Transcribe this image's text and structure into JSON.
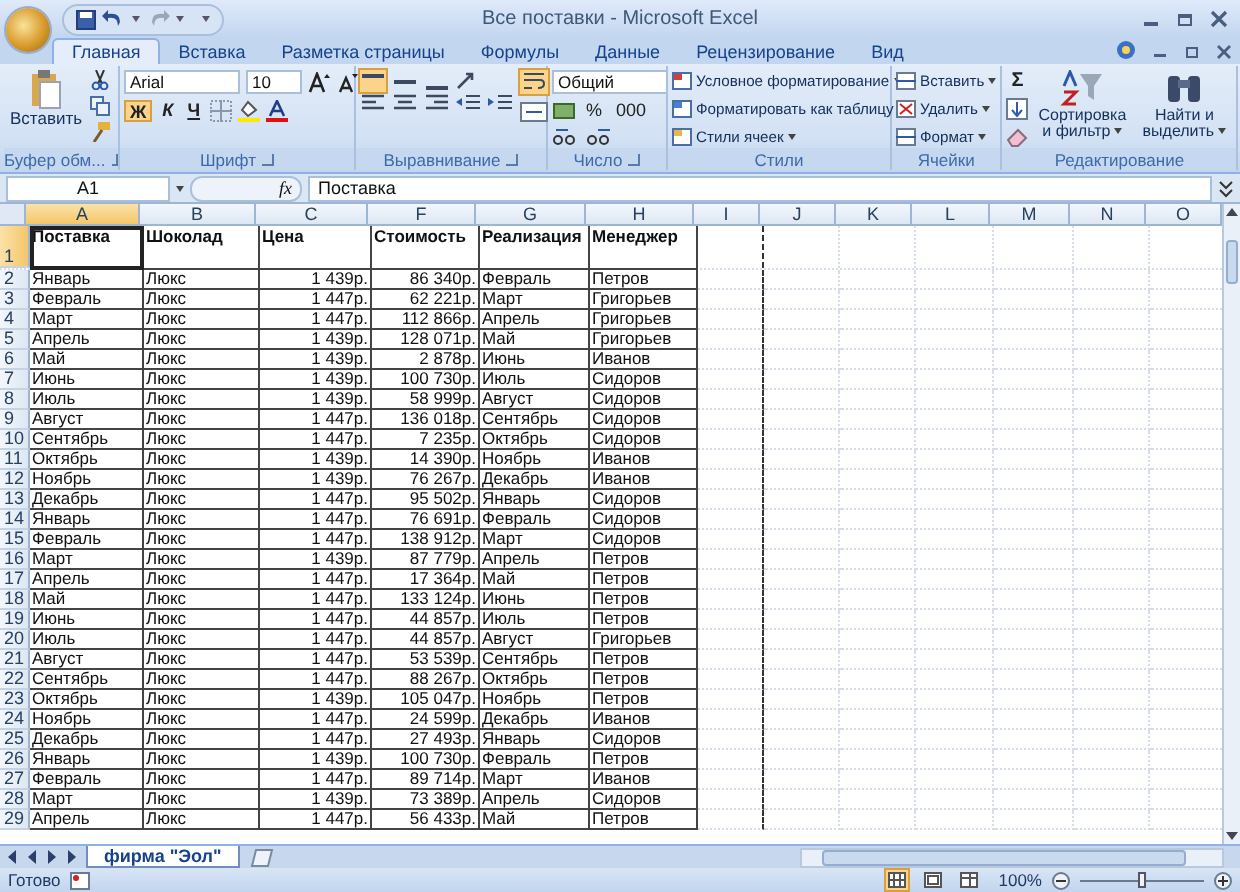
{
  "window": {
    "title": "Все поставки - Microsoft Excel"
  },
  "tabs": [
    {
      "label": "Главная",
      "selected": true
    },
    {
      "label": "Вставка",
      "selected": false
    },
    {
      "label": "Разметка страницы",
      "selected": false
    },
    {
      "label": "Формулы",
      "selected": false
    },
    {
      "label": "Данные",
      "selected": false
    },
    {
      "label": "Рецензирование",
      "selected": false
    },
    {
      "label": "Вид",
      "selected": false
    }
  ],
  "clipboard": {
    "paste": "Вставить",
    "label": "Буфер обм..."
  },
  "font": {
    "name": "Arial",
    "size": "10",
    "bold": "Ж",
    "italic": "К",
    "underline": "Ч",
    "label": "Шрифт"
  },
  "alignment": {
    "label": "Выравнивание"
  },
  "number": {
    "format": "Общий",
    "percent": "%",
    "thousands": "000",
    "label": "Число"
  },
  "styles": {
    "items": [
      "Условное форматирование",
      "Форматировать как таблицу",
      "Стили ячеек"
    ],
    "label": "Стили"
  },
  "cells": {
    "items": [
      "Вставить",
      "Удалить",
      "Формат"
    ],
    "label": "Ячейки"
  },
  "editing": {
    "sum": "Σ",
    "sort": "Сортировка и фильтр",
    "find": "Найти и выделить",
    "label": "Редактирование"
  },
  "formula_bar": {
    "cell": "A1",
    "function_label": "fx",
    "value": "Поставка"
  },
  "sheet": {
    "columns": [
      {
        "label": "A",
        "kind": "text",
        "selected": true
      },
      {
        "label": "B",
        "kind": "text",
        "selected": false
      },
      {
        "label": "C",
        "kind": "number",
        "selected": false
      },
      {
        "label": "F",
        "kind": "number",
        "selected": false
      },
      {
        "label": "G",
        "kind": "text",
        "selected": false
      },
      {
        "label": "H",
        "kind": "text",
        "selected": false
      },
      {
        "label": "I",
        "kind": "text",
        "selected": false
      },
      {
        "label": "J",
        "kind": "text",
        "selected": false
      },
      {
        "label": "K",
        "kind": "text",
        "selected": false
      },
      {
        "label": "L",
        "kind": "text",
        "selected": false
      },
      {
        "label": "M",
        "kind": "text",
        "selected": false
      },
      {
        "label": "N",
        "kind": "text",
        "selected": false
      },
      {
        "label": "O",
        "kind": "text",
        "selected": false
      }
    ],
    "rows": [
      {
        "number": "1",
        "kind": "header",
        "selected": true,
        "cells": [
          "Поставка",
          "Шоколад",
          "Цена",
          "Стоимость",
          "Реализация",
          "Менеджер"
        ]
      },
      {
        "number": "2",
        "kind": "data",
        "selected": false,
        "cells": [
          "Январь",
          "Люкс",
          "1 439р.",
          "86 340р.",
          "Февраль",
          "Петров"
        ]
      },
      {
        "number": "3",
        "kind": "data",
        "selected": false,
        "cells": [
          "Февраль",
          "Люкс",
          "1 447р.",
          "62 221р.",
          "Март",
          "Григорьев"
        ]
      },
      {
        "number": "4",
        "kind": "data",
        "selected": false,
        "cells": [
          "Март",
          "Люкс",
          "1 447р.",
          "112 866р.",
          "Апрель",
          "Григорьев"
        ]
      },
      {
        "number": "5",
        "kind": "data",
        "selected": false,
        "cells": [
          "Апрель",
          "Люкс",
          "1 439р.",
          "128 071р.",
          "Май",
          "Григорьев"
        ]
      },
      {
        "number": "6",
        "kind": "data",
        "selected": false,
        "cells": [
          "Май",
          "Люкс",
          "1 439р.",
          "2 878р.",
          "Июнь",
          "Иванов"
        ]
      },
      {
        "number": "7",
        "kind": "data",
        "selected": false,
        "cells": [
          "Июнь",
          "Люкс",
          "1 439р.",
          "100 730р.",
          "Июль",
          "Сидоров"
        ]
      },
      {
        "number": "8",
        "kind": "data",
        "selected": false,
        "cells": [
          "Июль",
          "Люкс",
          "1 439р.",
          "58 999р.",
          "Август",
          "Сидоров"
        ]
      },
      {
        "number": "9",
        "kind": "data",
        "selected": false,
        "cells": [
          "Август",
          "Люкс",
          "1 447р.",
          "136 018р.",
          "Сентябрь",
          "Сидоров"
        ]
      },
      {
        "number": "10",
        "kind": "data",
        "selected": false,
        "cells": [
          "Сентябрь",
          "Люкс",
          "1 447р.",
          "7 235р.",
          "Октябрь",
          "Сидоров"
        ]
      },
      {
        "number": "11",
        "kind": "data",
        "selected": false,
        "cells": [
          "Октябрь",
          "Люкс",
          "1 439р.",
          "14 390р.",
          "Ноябрь",
          "Иванов"
        ]
      },
      {
        "number": "12",
        "kind": "data",
        "selected": false,
        "cells": [
          "Ноябрь",
          "Люкс",
          "1 439р.",
          "76 267р.",
          "Декабрь",
          "Иванов"
        ]
      },
      {
        "number": "13",
        "kind": "data",
        "selected": false,
        "cells": [
          "Декабрь",
          "Люкс",
          "1 447р.",
          "95 502р.",
          "Январь",
          "Сидоров"
        ]
      },
      {
        "number": "14",
        "kind": "data",
        "selected": false,
        "cells": [
          "Январь",
          "Люкс",
          "1 447р.",
          "76 691р.",
          "Февраль",
          "Сидоров"
        ]
      },
      {
        "number": "15",
        "kind": "data",
        "selected": false,
        "cells": [
          "Февраль",
          "Люкс",
          "1 447р.",
          "138 912р.",
          "Март",
          "Сидоров"
        ]
      },
      {
        "number": "16",
        "kind": "data",
        "selected": false,
        "cells": [
          "Март",
          "Люкс",
          "1 439р.",
          "87 779р.",
          "Апрель",
          "Петров"
        ]
      },
      {
        "number": "17",
        "kind": "data",
        "selected": false,
        "cells": [
          "Апрель",
          "Люкс",
          "1 447р.",
          "17 364р.",
          "Май",
          "Петров"
        ]
      },
      {
        "number": "18",
        "kind": "data",
        "selected": false,
        "cells": [
          "Май",
          "Люкс",
          "1 447р.",
          "133 124р.",
          "Июнь",
          "Петров"
        ]
      },
      {
        "number": "19",
        "kind": "data",
        "selected": false,
        "cells": [
          "Июнь",
          "Люкс",
          "1 447р.",
          "44 857р.",
          "Июль",
          "Петров"
        ]
      },
      {
        "number": "20",
        "kind": "data",
        "selected": false,
        "cells": [
          "Июль",
          "Люкс",
          "1 447р.",
          "44 857р.",
          "Август",
          "Григорьев"
        ]
      },
      {
        "number": "21",
        "kind": "data",
        "selected": false,
        "cells": [
          "Август",
          "Люкс",
          "1 447р.",
          "53 539р.",
          "Сентябрь",
          "Петров"
        ]
      },
      {
        "number": "22",
        "kind": "data",
        "selected": false,
        "cells": [
          "Сентябрь",
          "Люкс",
          "1 447р.",
          "88 267р.",
          "Октябрь",
          "Петров"
        ]
      },
      {
        "number": "23",
        "kind": "data",
        "selected": false,
        "cells": [
          "Октябрь",
          "Люкс",
          "1 439р.",
          "105 047р.",
          "Ноябрь",
          "Петров"
        ]
      },
      {
        "number": "24",
        "kind": "data",
        "selected": false,
        "cells": [
          "Ноябрь",
          "Люкс",
          "1 447р.",
          "24 599р.",
          "Декабрь",
          "Иванов"
        ]
      },
      {
        "number": "25",
        "kind": "data",
        "selected": false,
        "cells": [
          "Декабрь",
          "Люкс",
          "1 447р.",
          "27 493р.",
          "Январь",
          "Сидоров"
        ]
      },
      {
        "number": "26",
        "kind": "data",
        "selected": false,
        "cells": [
          "Январь",
          "Люкс",
          "1 439р.",
          "100 730р.",
          "Февраль",
          "Петров"
        ]
      },
      {
        "number": "27",
        "kind": "data",
        "selected": false,
        "cells": [
          "Февраль",
          "Люкс",
          "1 447р.",
          "89 714р.",
          "Март",
          "Иванов"
        ]
      },
      {
        "number": "28",
        "kind": "data",
        "selected": false,
        "cells": [
          "Март",
          "Люкс",
          "1 439р.",
          "73 389р.",
          "Апрель",
          "Сидоров"
        ]
      },
      {
        "number": "29",
        "kind": "data",
        "selected": false,
        "cells": [
          "Апрель",
          "Люкс",
          "1 447р.",
          "56 433р.",
          "Май",
          "Петров"
        ]
      }
    ]
  },
  "sheet_tabs": [
    {
      "label": "фирма \"Эол\"",
      "selected": true
    }
  ],
  "status_bar": {
    "text": "Готово",
    "views": [
      {
        "selected": true
      },
      {
        "selected": false
      },
      {
        "selected": false
      }
    ],
    "zoom": "100%",
    "zoom_slider": {
      "level": 0.5
    }
  }
}
